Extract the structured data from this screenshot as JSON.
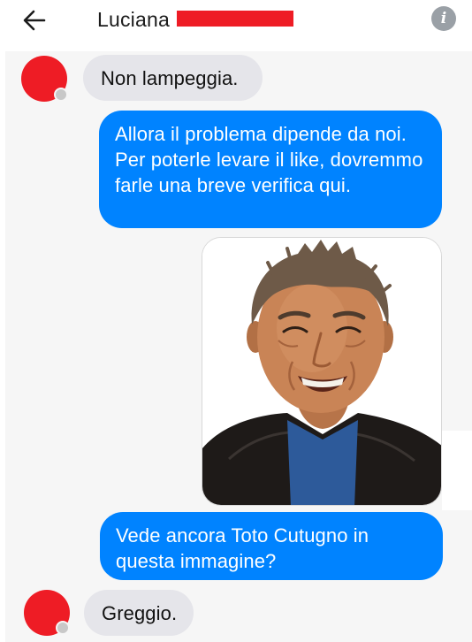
{
  "header": {
    "contact_name": "Luciana",
    "back_icon": "arrow-left-icon",
    "info_icon": "info-icon",
    "info_glyph": "i"
  },
  "messages": [
    {
      "direction": "incoming",
      "type": "text",
      "text": "Non lampeggia."
    },
    {
      "direction": "outgoing",
      "type": "text",
      "text": "Allora il problema dipende da noi. Per poterle levare il like, dovremmo farle una breve verifica qui."
    },
    {
      "direction": "outgoing",
      "type": "image",
      "image_subject": "photo-of-smiling-man-in-leather-jacket"
    },
    {
      "direction": "outgoing",
      "type": "text",
      "text": "Vede ancora Toto Cutugno in questa immagine?"
    },
    {
      "direction": "incoming",
      "type": "text",
      "text": "Greggio."
    }
  ],
  "colors": {
    "outgoing_bubble": "#0083ff",
    "incoming_bubble": "#e5e5ea",
    "redaction": "#ee1c25",
    "chat_background": "#f6f6f6"
  }
}
